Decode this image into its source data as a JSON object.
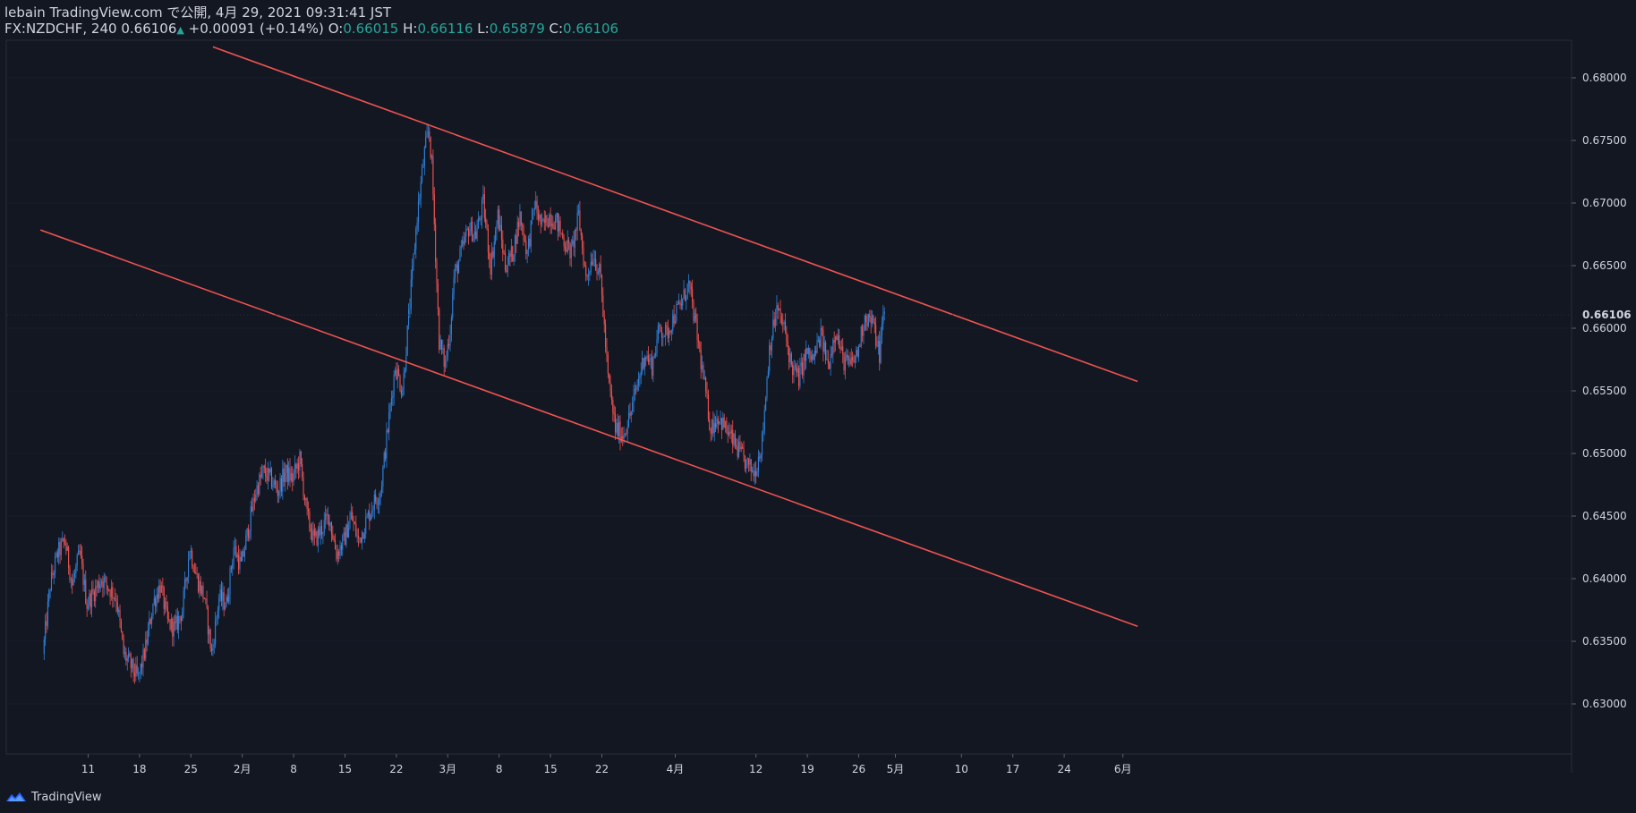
{
  "header": {
    "line1": "lebain TradingView.com で公開, 4月 29, 2021 09:31:41 JST",
    "symbol": "FX:NZDCHF, 240",
    "last": "0.66106",
    "change": "+0.00091 (+0.14%)",
    "o_label": "O:",
    "o_value": "0.66015",
    "h_label": "H:",
    "h_value": "0.66116",
    "l_label": "L:",
    "l_value": "0.65879",
    "c_label": "C:",
    "c_value": "0.66106"
  },
  "footer": {
    "brand": "TradingView"
  },
  "colors": {
    "background": "#131722",
    "up": "#2f80d8",
    "down": "#ef5350",
    "channel": "#ef5350",
    "axis_text": "#d1d4dc",
    "label_bg": "#131722"
  },
  "chart_data": {
    "type": "candlestick",
    "symbol": "FX:NZDCHF",
    "interval": "240",
    "ylim": [
      0.626,
      0.683
    ],
    "y_ticks": [
      "0.68000",
      "0.67500",
      "0.67000",
      "0.66500",
      "0.66000",
      "0.65500",
      "0.65000",
      "0.64500",
      "0.64000",
      "0.63500",
      "0.63000"
    ],
    "current_price_label": "0.66106",
    "current_price": 0.66106,
    "x_ticks": [
      {
        "label": "11",
        "day": 11
      },
      {
        "label": "18",
        "day": 18
      },
      {
        "label": "25",
        "day": 25
      },
      {
        "label": "2月",
        "day": 32
      },
      {
        "label": "8",
        "day": 39
      },
      {
        "label": "15",
        "day": 46
      },
      {
        "label": "22",
        "day": 53
      },
      {
        "label": "3月",
        "day": 60
      },
      {
        "label": "8",
        "day": 67
      },
      {
        "label": "15",
        "day": 74
      },
      {
        "label": "22",
        "day": 81
      },
      {
        "label": "4月",
        "day": 91
      },
      {
        "label": "12",
        "day": 102
      },
      {
        "label": "19",
        "day": 109
      },
      {
        "label": "26",
        "day": 116
      },
      {
        "label": "5月",
        "day": 121
      },
      {
        "label": "10",
        "day": 130
      },
      {
        "label": "17",
        "day": 137
      },
      {
        "label": "24",
        "day": 144
      },
      {
        "label": "6月",
        "day": 152
      }
    ],
    "path": [
      [
        5,
        0.634
      ],
      [
        6,
        0.6395
      ],
      [
        7,
        0.642
      ],
      [
        8,
        0.643
      ],
      [
        9,
        0.6395
      ],
      [
        10,
        0.642
      ],
      [
        11,
        0.638
      ],
      [
        13,
        0.64
      ],
      [
        15,
        0.6385
      ],
      [
        16,
        0.634
      ],
      [
        17,
        0.633
      ],
      [
        18,
        0.632
      ],
      [
        19,
        0.6345
      ],
      [
        20,
        0.638
      ],
      [
        21,
        0.6395
      ],
      [
        22,
        0.6365
      ],
      [
        23,
        0.636
      ],
      [
        24,
        0.6375
      ],
      [
        25,
        0.6425
      ],
      [
        26,
        0.64
      ],
      [
        27,
        0.6385
      ],
      [
        28,
        0.634
      ],
      [
        29,
        0.6385
      ],
      [
        30,
        0.638
      ],
      [
        31,
        0.6425
      ],
      [
        32,
        0.641
      ],
      [
        33,
        0.644
      ],
      [
        34,
        0.647
      ],
      [
        35,
        0.6485
      ],
      [
        36,
        0.648
      ],
      [
        37,
        0.647
      ],
      [
        38,
        0.6485
      ],
      [
        39,
        0.648
      ],
      [
        40,
        0.6495
      ],
      [
        41,
        0.645
      ],
      [
        42,
        0.643
      ],
      [
        43,
        0.644
      ],
      [
        44,
        0.645
      ],
      [
        45,
        0.642
      ],
      [
        46,
        0.643
      ],
      [
        47,
        0.645
      ],
      [
        48,
        0.643
      ],
      [
        49,
        0.6445
      ],
      [
        50,
        0.646
      ],
      [
        51,
        0.647
      ],
      [
        52,
        0.652
      ],
      [
        53,
        0.657
      ],
      [
        54,
        0.655
      ],
      [
        55,
        0.662
      ],
      [
        56,
        0.669
      ],
      [
        57,
        0.674
      ],
      [
        57.6,
        0.676
      ],
      [
        58,
        0.673
      ],
      [
        59,
        0.659
      ],
      [
        59.8,
        0.657
      ],
      [
        60.5,
        0.66
      ],
      [
        61,
        0.664
      ],
      [
        62,
        0.666
      ],
      [
        63,
        0.668
      ],
      [
        64,
        0.6675
      ],
      [
        65,
        0.67
      ],
      [
        66,
        0.665
      ],
      [
        67,
        0.669
      ],
      [
        68,
        0.665
      ],
      [
        69,
        0.666
      ],
      [
        70,
        0.669
      ],
      [
        71,
        0.666
      ],
      [
        72,
        0.67
      ],
      [
        73,
        0.668
      ],
      [
        74,
        0.669
      ],
      [
        75,
        0.6685
      ],
      [
        76,
        0.667
      ],
      [
        77,
        0.666
      ],
      [
        78,
        0.669
      ],
      [
        79,
        0.664
      ],
      [
        80,
        0.666
      ],
      [
        81,
        0.664
      ],
      [
        82,
        0.656
      ],
      [
        83,
        0.652
      ],
      [
        84,
        0.6515
      ],
      [
        85,
        0.653
      ],
      [
        86,
        0.6555
      ],
      [
        87,
        0.658
      ],
      [
        88,
        0.657
      ],
      [
        89,
        0.66
      ],
      [
        90,
        0.6595
      ],
      [
        91,
        0.661
      ],
      [
        92,
        0.662
      ],
      [
        93,
        0.6635
      ],
      [
        94,
        0.66
      ],
      [
        95,
        0.656
      ],
      [
        96,
        0.652
      ],
      [
        97,
        0.653
      ],
      [
        98,
        0.652
      ],
      [
        99,
        0.651
      ],
      [
        100,
        0.65
      ],
      [
        101,
        0.649
      ],
      [
        102,
        0.6485
      ],
      [
        103,
        0.651
      ],
      [
        104,
        0.6585
      ],
      [
        105,
        0.6615
      ],
      [
        106,
        0.66
      ],
      [
        107,
        0.657
      ],
      [
        108,
        0.656
      ],
      [
        109,
        0.658
      ],
      [
        110,
        0.6575
      ],
      [
        111,
        0.6595
      ],
      [
        112,
        0.657
      ],
      [
        113,
        0.66
      ],
      [
        114,
        0.6575
      ],
      [
        115,
        0.657
      ],
      [
        116,
        0.658
      ],
      [
        117,
        0.661
      ],
      [
        118,
        0.6605
      ],
      [
        119,
        0.658
      ],
      [
        119.5,
        0.661
      ]
    ],
    "channel": {
      "upper": {
        "from": [
          28,
          0.68247
        ],
        "to": [
          154,
          0.65575
        ]
      },
      "lower": {
        "from": [
          4.5,
          0.66785
        ],
        "to": [
          154,
          0.6362
        ]
      }
    }
  }
}
